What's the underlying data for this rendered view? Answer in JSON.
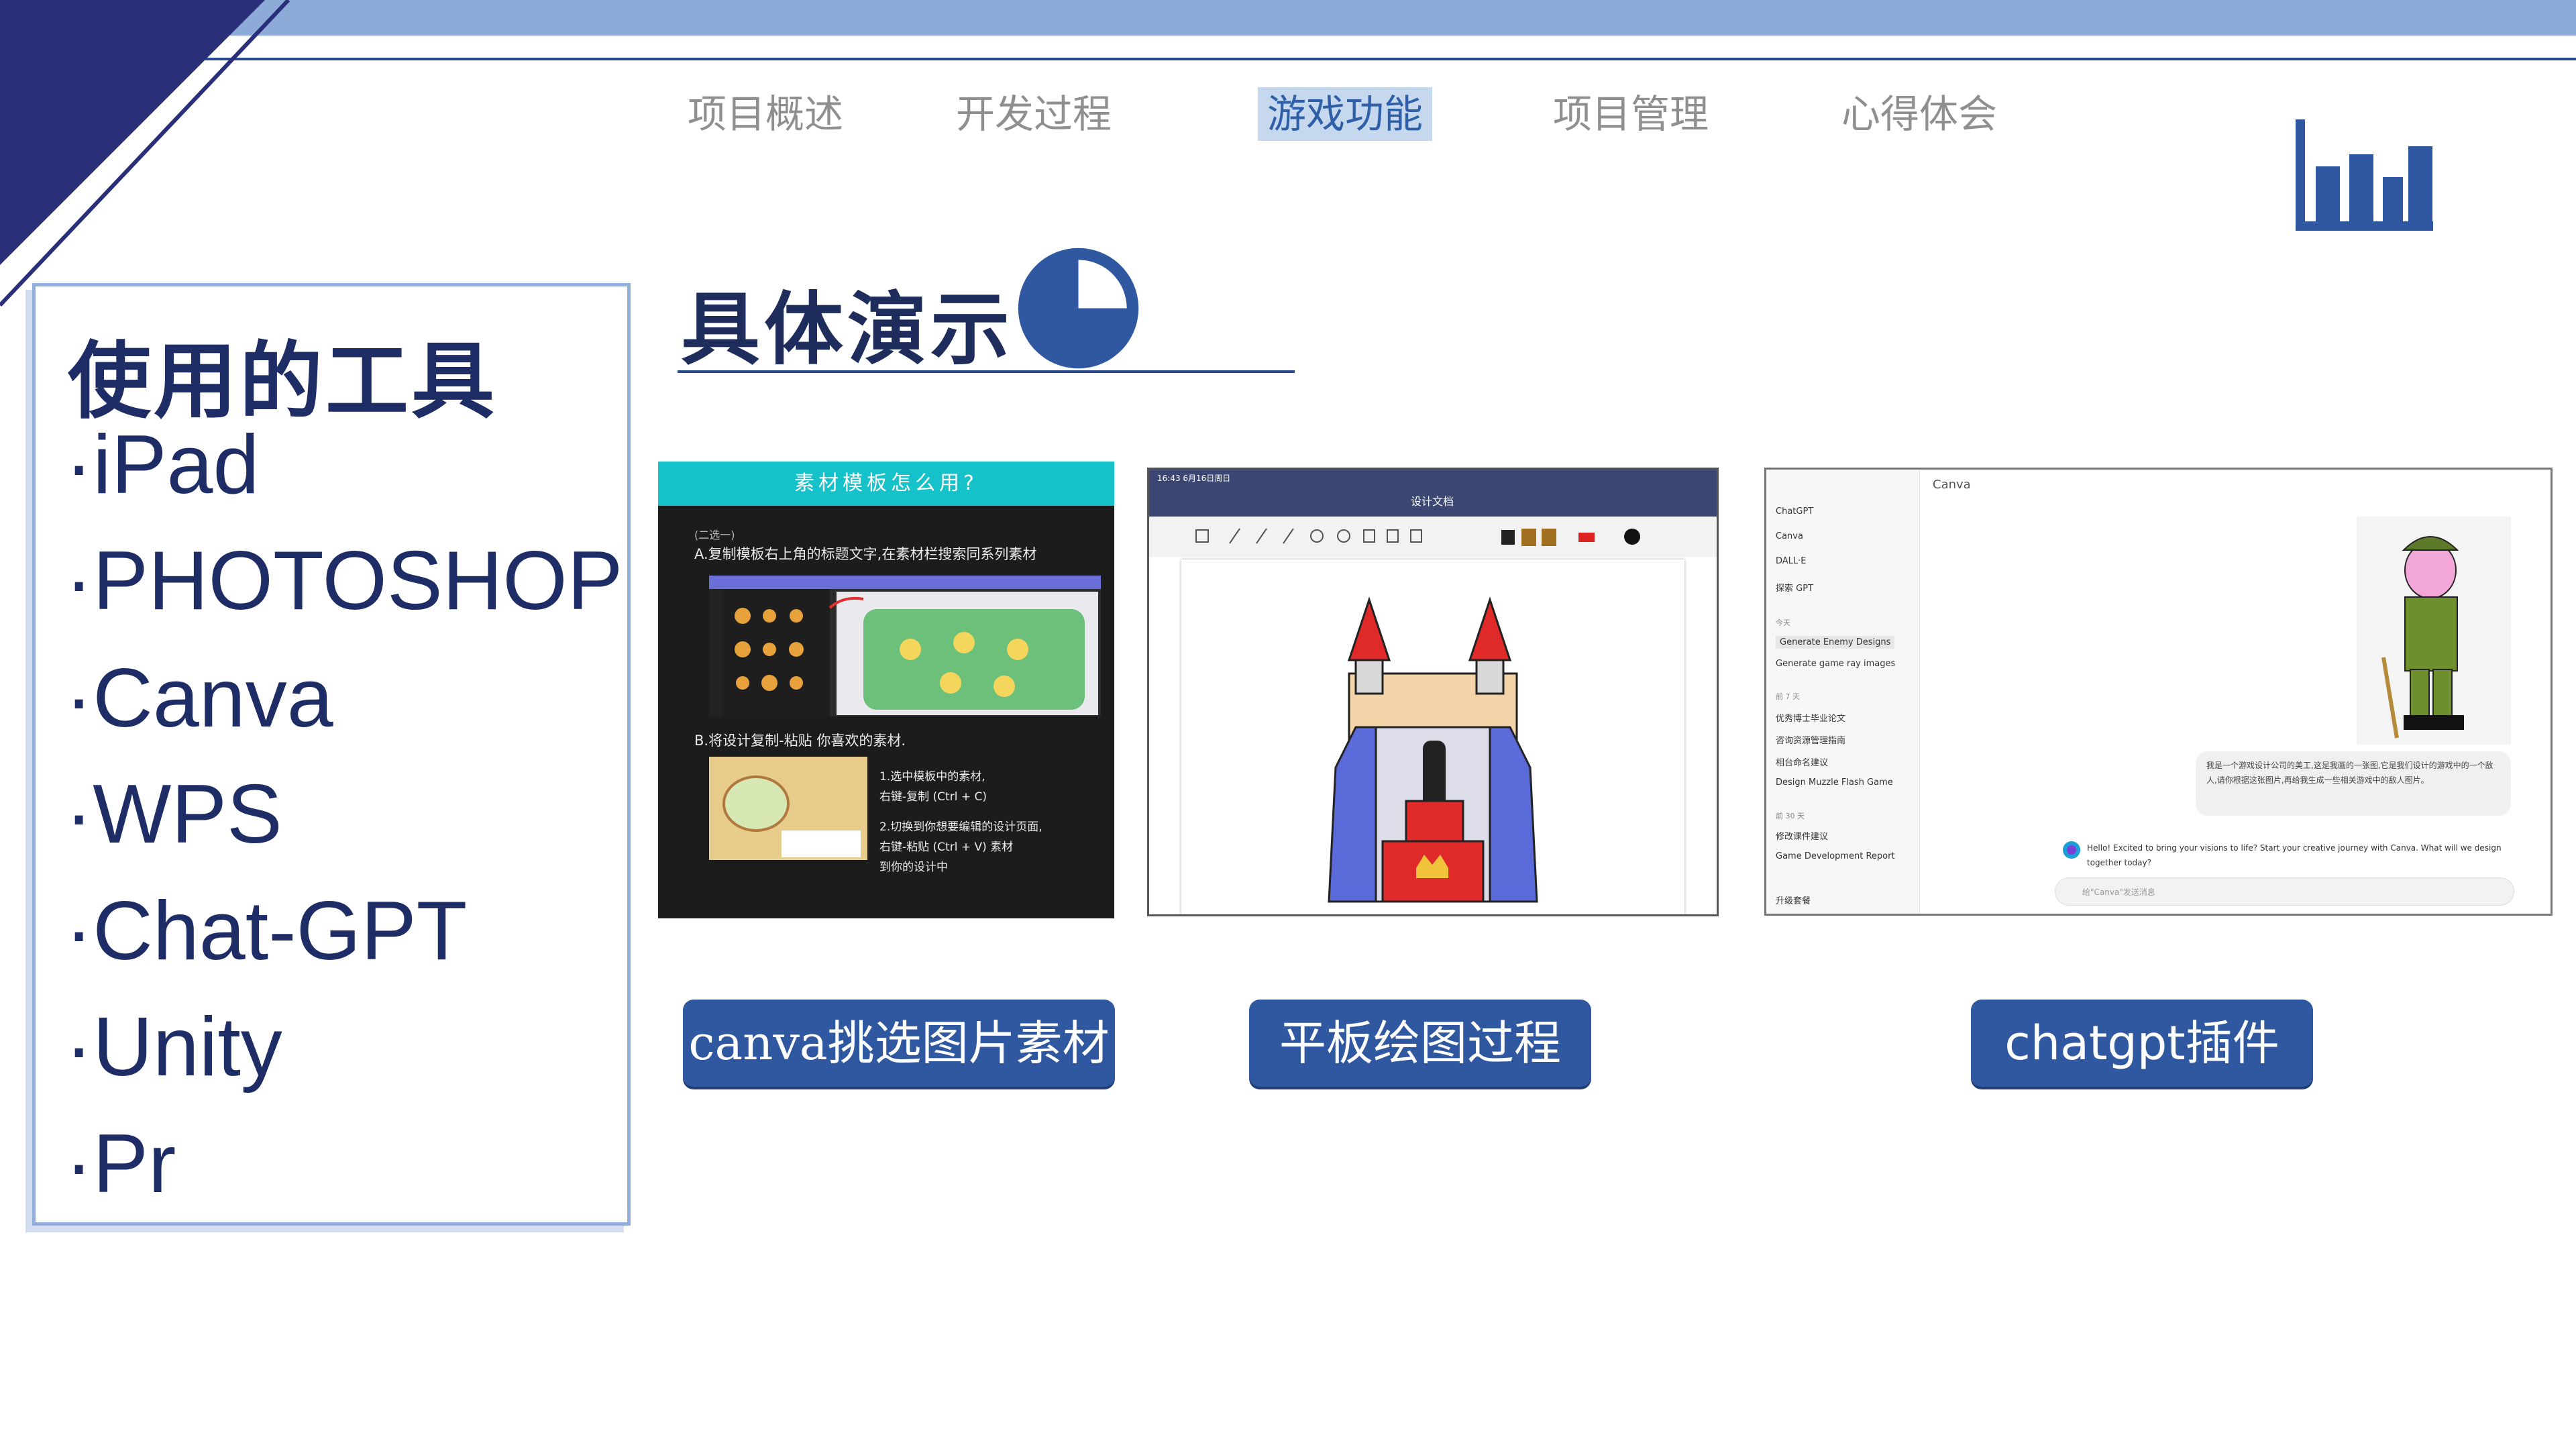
{
  "nav": {
    "items": [
      {
        "label": "项目概述",
        "active": false
      },
      {
        "label": "开发过程",
        "active": false
      },
      {
        "label": "游戏功能",
        "active": true
      },
      {
        "label": "项目管理",
        "active": false
      },
      {
        "label": "心得体会",
        "active": false
      }
    ]
  },
  "section": {
    "title": "具体演示"
  },
  "tools": {
    "heading": "使用的工具",
    "items": [
      "·iPad",
      "·PHOTOSHOP",
      "·Canva",
      "·WPS",
      "·Chat-GPT",
      "·Unity",
      "·Pr"
    ]
  },
  "screenshots": {
    "canva": {
      "header": "素材模板怎么用?",
      "step_a": "A.复制模板右上角的标题文字,在素材栏搜索同系列素材",
      "step_b": "B.将设计复制-粘贴 你喜欢的素材.",
      "step_b1": "1.选中模板中的素材,",
      "step_b1b": "右键-复制 (Ctrl + C)",
      "step_b2": "2.切换到你想要编辑的设计页面,",
      "step_b2b": "右键-粘贴 (Ctrl + V) 素材",
      "step_b2c": "到你的设计中",
      "sub": "(二选一)"
    },
    "tablet": {
      "doc_title": "设计文档",
      "status_time": "16:43 6月16日周日"
    },
    "chatgpt": {
      "header": "Canva",
      "sidebar": [
        "ChatGPT",
        "Canva",
        "DALL·E",
        "探索 GPT"
      ],
      "today_label": "今天",
      "history": [
        "Generate Enemy Designs",
        "Generate game ray images"
      ],
      "week_label": "前 7 天",
      "history2": [
        "优秀博士毕业论文",
        "咨询资源管理指南",
        "相台命名建议",
        "Design Muzzle Flash Game"
      ],
      "month_label": "前 30 天",
      "history3": [
        "修改课件建议",
        "Game Development Report",
        "升级套餐"
      ],
      "user_msg": "我是一个游戏设计公司的美工,这是我画的一张图,它是我们设计的游戏中的一个敌人,请你根据这张图片,再给我生成一些相关游戏中的敌人图片。",
      "reply": "Hello! Excited to bring your visions to life? Start your creative journey with Canva. What will we design together today?",
      "input_placeholder": "给\"Canva\"发送消息"
    }
  },
  "buttons": {
    "canva": "canva挑选图片素材",
    "tablet": "平板绘图过程",
    "chatgpt": "chatgpt插件"
  },
  "colors": {
    "navy": "#1f2d67",
    "accent": "#2f58a0",
    "band": "#8eaad9",
    "nav_active_bg": "#c6d8ee"
  }
}
